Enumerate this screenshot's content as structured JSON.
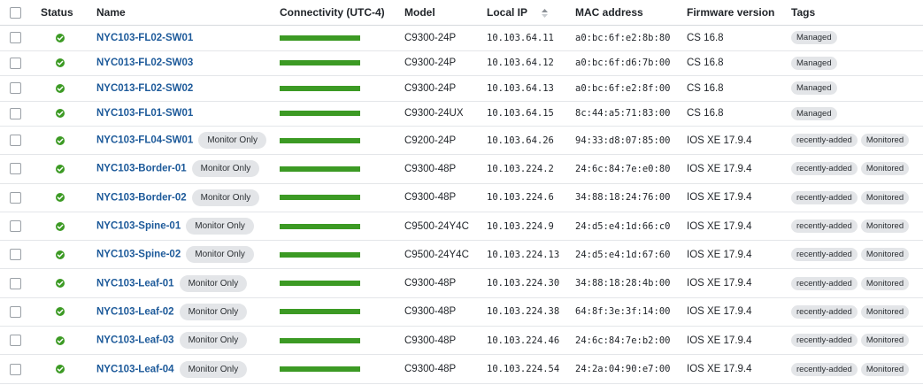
{
  "columns": {
    "status": "Status",
    "name": "Name",
    "connectivity": "Connectivity (UTC-4)",
    "model": "Model",
    "local_ip": "Local IP",
    "mac": "MAC address",
    "firmware": "Firmware version",
    "tags": "Tags"
  },
  "colors": {
    "status_ok": "#3c9a24",
    "connectivity": "#3c9a24",
    "link": "#1d5a9a",
    "pill_bg": "#e3e5e8"
  },
  "icons": {
    "status": "check-circle-icon",
    "sort": "sort-icon",
    "checkbox": "checkbox-icon"
  },
  "rows": [
    {
      "name": "NYC103-FL02-SW01",
      "badge": "",
      "connectivity": 1.0,
      "model": "C9300-24P",
      "ip": "10.103.64.11",
      "mac": "a0:bc:6f:e2:8b:80",
      "firmware": "CS 16.8",
      "tags": [
        "Managed"
      ]
    },
    {
      "name": "NYC013-FL02-SW03",
      "badge": "",
      "connectivity": 1.0,
      "model": "C9300-24P",
      "ip": "10.103.64.12",
      "mac": "a0:bc:6f:d6:7b:00",
      "firmware": "CS 16.8",
      "tags": [
        "Managed"
      ]
    },
    {
      "name": "NYC013-FL02-SW02",
      "badge": "",
      "connectivity": 1.0,
      "model": "C9300-24P",
      "ip": "10.103.64.13",
      "mac": "a0:bc:6f:e2:8f:00",
      "firmware": "CS 16.8",
      "tags": [
        "Managed"
      ]
    },
    {
      "name": "NYC103-FL01-SW01",
      "badge": "",
      "connectivity": 1.0,
      "model": "C9300-24UX",
      "ip": "10.103.64.15",
      "mac": "8c:44:a5:71:83:00",
      "firmware": "CS 16.8",
      "tags": [
        "Managed"
      ]
    },
    {
      "name": "NYC103-FL04-SW01",
      "badge": "Monitor Only",
      "connectivity": 1.0,
      "model": "C9200-24P",
      "ip": "10.103.64.26",
      "mac": "94:33:d8:07:85:00",
      "firmware": "IOS XE 17.9.4",
      "tags": [
        "recently-added",
        "Monitored"
      ]
    },
    {
      "name": "NYC103-Border-01",
      "badge": "Monitor Only",
      "connectivity": 1.0,
      "model": "C9300-48P",
      "ip": "10.103.224.2",
      "mac": "24:6c:84:7e:e0:80",
      "firmware": "IOS XE 17.9.4",
      "tags": [
        "recently-added",
        "Monitored"
      ]
    },
    {
      "name": "NYC103-Border-02",
      "badge": "Monitor Only",
      "connectivity": 1.0,
      "model": "C9300-48P",
      "ip": "10.103.224.6",
      "mac": "34:88:18:24:76:00",
      "firmware": "IOS XE 17.9.4",
      "tags": [
        "recently-added",
        "Monitored"
      ]
    },
    {
      "name": "NYC103-Spine-01",
      "badge": "Monitor Only",
      "connectivity": 1.0,
      "model": "C9500-24Y4C",
      "ip": "10.103.224.9",
      "mac": "24:d5:e4:1d:66:c0",
      "firmware": "IOS XE 17.9.4",
      "tags": [
        "recently-added",
        "Monitored"
      ]
    },
    {
      "name": "NYC103-Spine-02",
      "badge": "Monitor Only",
      "connectivity": 1.0,
      "model": "C9500-24Y4C",
      "ip": "10.103.224.13",
      "mac": "24:d5:e4:1d:67:60",
      "firmware": "IOS XE 17.9.4",
      "tags": [
        "recently-added",
        "Monitored"
      ]
    },
    {
      "name": "NYC103-Leaf-01",
      "badge": "Monitor Only",
      "connectivity": 1.0,
      "model": "C9300-48P",
      "ip": "10.103.224.30",
      "mac": "34:88:18:28:4b:00",
      "firmware": "IOS XE 17.9.4",
      "tags": [
        "recently-added",
        "Monitored"
      ]
    },
    {
      "name": "NYC103-Leaf-02",
      "badge": "Monitor Only",
      "connectivity": 1.0,
      "model": "C9300-48P",
      "ip": "10.103.224.38",
      "mac": "64:8f:3e:3f:14:00",
      "firmware": "IOS XE 17.9.4",
      "tags": [
        "recently-added",
        "Monitored"
      ]
    },
    {
      "name": "NYC103-Leaf-03",
      "badge": "Monitor Only",
      "connectivity": 1.0,
      "model": "C9300-48P",
      "ip": "10.103.224.46",
      "mac": "24:6c:84:7e:b2:00",
      "firmware": "IOS XE 17.9.4",
      "tags": [
        "recently-added",
        "Monitored"
      ]
    },
    {
      "name": "NYC103-Leaf-04",
      "badge": "Monitor Only",
      "connectivity": 1.0,
      "model": "C9300-48P",
      "ip": "10.103.224.54",
      "mac": "24:2a:04:90:e7:00",
      "firmware": "IOS XE 17.9.4",
      "tags": [
        "recently-added",
        "Monitored"
      ]
    }
  ]
}
